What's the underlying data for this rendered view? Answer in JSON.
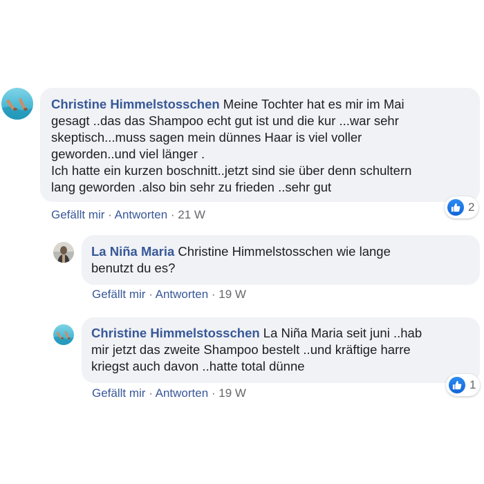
{
  "comments": [
    {
      "author": "Christine Himmelstosschen",
      "lines": [
        " Meine Tochter hat es mir im Mai",
        "gesagt ..das das Shampoo echt gut ist und die kur ...war sehr",
        "skeptisch...muss sagen mein dünnes Haar is viel voller",
        "geworden..und viel länger .",
        "Ich hatte ein kurzen boschnitt..jetzt sind sie über denn schultern",
        "lang geworden .also bin sehr zu frieden ..sehr gut"
      ],
      "like_label": "Gefällt mir",
      "reply_label": "Antworten",
      "separator": " · ",
      "time": "21 W",
      "reaction_count": "2"
    },
    {
      "author": "La Niña Maria",
      "lines": [
        " Christine Himmelstosschen wie lange",
        "benutzt du es?"
      ],
      "like_label": "Gefällt mir",
      "reply_label": "Antworten",
      "separator": " · ",
      "time": "19 W"
    },
    {
      "author": "Christine Himmelstosschen",
      "lines": [
        " La Niña Maria seit juni ..hab",
        "mir jetzt das zweite Shampoo bestelt ..und kräftige harre",
        "kriegst auch davon ..hatte total dünne"
      ],
      "like_label": "Gefällt mir",
      "reply_label": "Antworten",
      "separator": " · ",
      "time": "19 W",
      "reaction_count": "1"
    }
  ],
  "icons": {
    "like": "thumbs-up-icon",
    "avatar_christine": "feet-in-pool-photo",
    "avatar_maria": "profile-photo"
  },
  "colors": {
    "author": "#385898",
    "bubble": "#f0f2f5",
    "meta_gray": "#65676b",
    "like_blue": "#1877f2"
  }
}
